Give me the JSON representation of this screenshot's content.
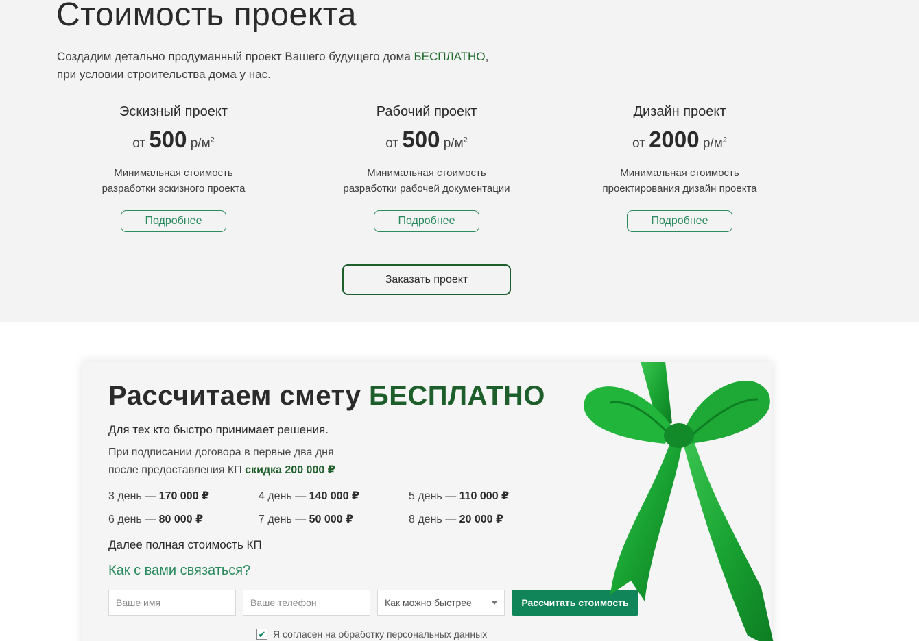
{
  "pricing": {
    "title": "Стоимость проекта",
    "intro_line1": "Создадим детально продуманный проект Вашего будущего дома ",
    "intro_highlight": "БЕСПЛАТНО",
    "intro_line1_end": ",",
    "intro_line2": "при условии строительства дома у нас.",
    "plans": [
      {
        "name": "Эскизный проект",
        "prefix": "от",
        "price": "500",
        "unit": "р/м",
        "unit_sup": "2",
        "desc1": "Минимальная стоимость",
        "desc2": "разработки эскизного проекта",
        "button": "Подробнее"
      },
      {
        "name": "Рабочий проект",
        "prefix": "от",
        "price": "500",
        "unit": "р/м",
        "unit_sup": "2",
        "desc1": "Минимальная стоимость",
        "desc2": "разработки рабочей документации",
        "button": "Подробнее"
      },
      {
        "name": "Дизайн проект",
        "prefix": "от",
        "price": "2000",
        "unit": "р/м",
        "unit_sup": "2",
        "desc1": "Минимальная стоимость",
        "desc2": "проектирования дизайн проекта",
        "button": "Подробнее"
      }
    ],
    "order_button": "Заказать проект"
  },
  "promo": {
    "title_plain": "Рассчитаем смету ",
    "title_green": "БЕСПЛАТНО",
    "subtitle": "Для тех кто быстро принимает решения.",
    "text_line1": "При подписании договора в первые два дня",
    "text_line2": "после предоставления КП ",
    "text_discount": "скидка 200 000 ₽",
    "days": [
      {
        "day": "3 день — ",
        "amount": "170 000 ₽"
      },
      {
        "day": "4 день — ",
        "amount": "140 000 ₽"
      },
      {
        "day": "5 день — ",
        "amount": "110 000 ₽"
      },
      {
        "day": "6 день — ",
        "amount": "80 000 ₽"
      },
      {
        "day": "7 день — ",
        "amount": "50 000 ₽"
      },
      {
        "day": "8 день — ",
        "amount": "20 000 ₽"
      }
    ],
    "full_price": "Далее полная стоимость КП",
    "contact_title": "Как с вами связаться?",
    "form": {
      "name_placeholder": "Ваше имя",
      "phone_placeholder": "Ваше телефон",
      "select_value": "Как можно быстрее",
      "submit": "Рассчитать стоимость"
    },
    "consent": "Я согласен на обработку персональных данных",
    "consent_checked": true,
    "colors": {
      "accent": "#10855a",
      "dark_green": "#1e5e2a",
      "ribbon": "#1fae3a"
    }
  }
}
